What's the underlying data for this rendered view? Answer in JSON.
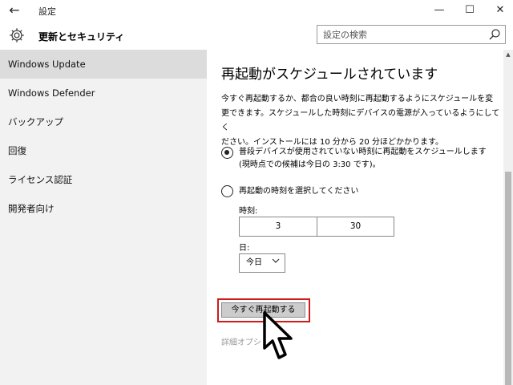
{
  "window": {
    "title": "設定",
    "back_glyph": "←",
    "minimize_glyph": "—",
    "maximize_glyph": "☐",
    "close_glyph": "✕"
  },
  "header": {
    "section_title": "更新とセキュリティ",
    "search_placeholder": "設定の検索",
    "icons": {
      "section": "gear-icon",
      "search": "search-icon"
    }
  },
  "sidebar": {
    "items": [
      {
        "label": "Windows Update",
        "active": true
      },
      {
        "label": "Windows Defender",
        "active": false
      },
      {
        "label": "バックアップ",
        "active": false
      },
      {
        "label": "回復",
        "active": false
      },
      {
        "label": "ライセンス認証",
        "active": false
      },
      {
        "label": "開発者向け",
        "active": false
      }
    ]
  },
  "main": {
    "heading": "再起動がスケジュールされています",
    "description_lines": [
      "今すぐ再起動するか、都合の良い時刻に再起動するようにスケジュールを変",
      "更できます。スケジュールした時刻にデバイスの電源が入っているようにしてく",
      "ださい。インストールには 10 分から 20 分ほどかかります。"
    ],
    "option_auto_line1": "普段デバイスが使用されていない時刻に再起動をスケジュールします",
    "option_auto_line2": "(現時点での候補は今日の 3:30 です)。",
    "option_custom": "再起動の時刻を選択してください",
    "time_label": "時刻:",
    "time_hour": "3",
    "time_minute": "30",
    "day_label": "日:",
    "day_value": "今日",
    "restart_now_button": "今すぐ再起動する",
    "advanced_link": "詳細オプショ"
  },
  "colors": {
    "highlight_border": "#d11a1a",
    "sidebar_bg": "#f2f2f2",
    "sidebar_active": "#dcdcdc",
    "link_gray": "#9a9a9a"
  }
}
